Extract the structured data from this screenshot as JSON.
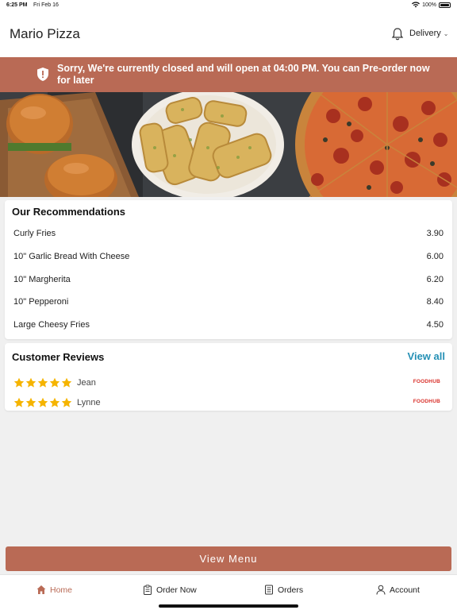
{
  "status_bar": {
    "time": "6:25 PM",
    "date": "Fri Feb 16",
    "battery": "100%",
    "wifi_icon": "wifi-icon",
    "battery_icon": "battery-icon"
  },
  "header": {
    "title": "Mario Pizza",
    "bell_icon": "bell-icon",
    "delivery_label": "Delivery",
    "delivery_icon": "chevron-down-icon"
  },
  "banner": {
    "message": "Sorry, We're currently closed and will open at 04:00 PM. You can Pre-order now for later",
    "icon": "shield-icon",
    "color": "#b96a55"
  },
  "hero": {
    "icon": "food-banner-image"
  },
  "recommendations": {
    "title": "Our Recommendations",
    "items": [
      {
        "name": "Curly Fries",
        "price": "3.90"
      },
      {
        "name": "10\" Garlic Bread With Cheese",
        "price": "6.00"
      },
      {
        "name": "10\" Margherita",
        "price": "6.20"
      },
      {
        "name": "10\" Pepperoni",
        "price": "8.40"
      },
      {
        "name": "Large Cheesy Fries",
        "price": "4.50"
      }
    ]
  },
  "reviews": {
    "title": "Customer Reviews",
    "view_all": "View all",
    "items": [
      {
        "name": "Jean",
        "rating": 5,
        "source": "FOODHUB"
      },
      {
        "name": "Lynne",
        "rating": 5,
        "source": "FOODHUB"
      }
    ],
    "star_color": "#f5b400",
    "link_color": "#2590b5"
  },
  "view_menu": {
    "label": "View Menu"
  },
  "tabs": [
    {
      "label": "Home",
      "icon": "home-icon",
      "active": true
    },
    {
      "label": "Order Now",
      "icon": "clipboard-icon",
      "active": false
    },
    {
      "label": "Orders",
      "icon": "receipt-icon",
      "active": false
    },
    {
      "label": "Account",
      "icon": "user-icon",
      "active": false
    }
  ]
}
